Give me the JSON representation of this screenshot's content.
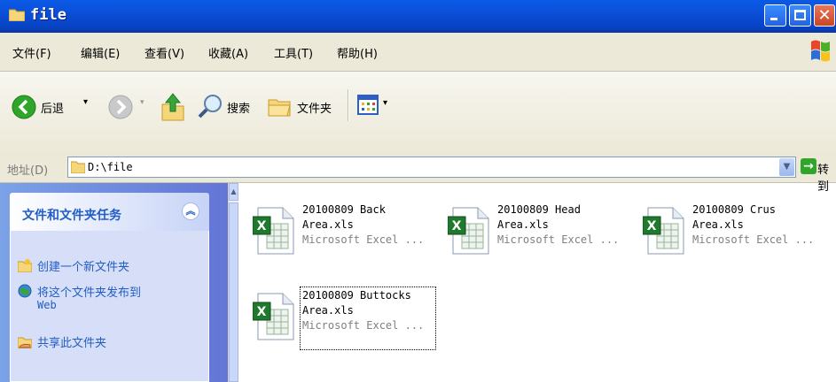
{
  "window": {
    "title": "file"
  },
  "menu": [
    "文件(F)",
    "编辑(E)",
    "查看(V)",
    "收藏(A)",
    "工具(T)",
    "帮助(H)"
  ],
  "toolbar": {
    "back": "后退",
    "search": "搜索",
    "folders": "文件夹"
  },
  "address": {
    "label": "地址(D)",
    "path": "D:\\file",
    "go": "转到"
  },
  "tasks": {
    "title": "文件和文件夹任务",
    "items": [
      {
        "label": "创建一个新文件夹",
        "icon": "new-folder-icon"
      },
      {
        "label": "将这个文件夹发布到",
        "label2": "Web",
        "icon": "publish-web-icon"
      },
      {
        "label": "共享此文件夹",
        "icon": "share-folder-icon"
      }
    ]
  },
  "files": [
    {
      "line1": "20100809 Back",
      "line2": "Area.xls",
      "type": "Microsoft Excel ..."
    },
    {
      "line1": "20100809 Head",
      "line2": "Area.xls",
      "type": "Microsoft Excel ..."
    },
    {
      "line1": "20100809 Crus",
      "line2": "Area.xls",
      "type": "Microsoft Excel ..."
    },
    {
      "line1": "20100809 Buttocks",
      "line2": "Area.xls",
      "type": "Microsoft Excel ..."
    }
  ],
  "colors": {
    "titlebar": "#0b4fd8",
    "task_link": "#215dc6",
    "excel_green": "#1f7a2e"
  }
}
